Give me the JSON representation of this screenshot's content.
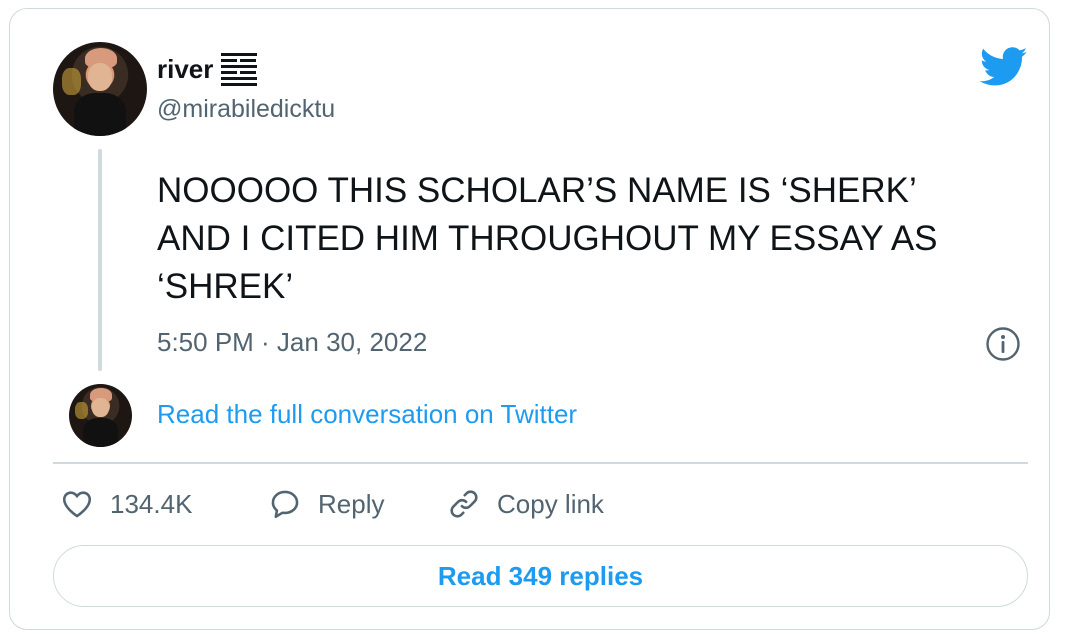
{
  "author": {
    "display_name": "river",
    "handle": "@mirabiledicktu",
    "hexagram": [
      [
        1
      ],
      [
        0
      ],
      [
        1
      ],
      [
        0
      ],
      [
        1
      ],
      [
        1
      ]
    ]
  },
  "tweet": {
    "text": "NOOOOO THIS SCHOLAR’S NAME IS ‘SHERK’\nAND I CITED HIM THROUGHOUT MY ESSAY AS\n‘SHREK’",
    "timestamp": "5:50 PM · Jan 30, 2022"
  },
  "conversation": {
    "link_label": "Read the full conversation on Twitter"
  },
  "actions": {
    "like_count": "134.4K",
    "reply_label": "Reply",
    "copy_label": "Copy link"
  },
  "replies_button": {
    "label": "Read 349 replies"
  },
  "icons": {
    "brand": "twitter-bird-icon",
    "info": "info-icon",
    "like": "heart-icon",
    "reply": "speech-bubble-icon",
    "copy": "link-icon"
  },
  "colors": {
    "accent": "#1d9bf0",
    "text": "#0f1419",
    "muted": "#536471",
    "border": "#cfd9de"
  }
}
